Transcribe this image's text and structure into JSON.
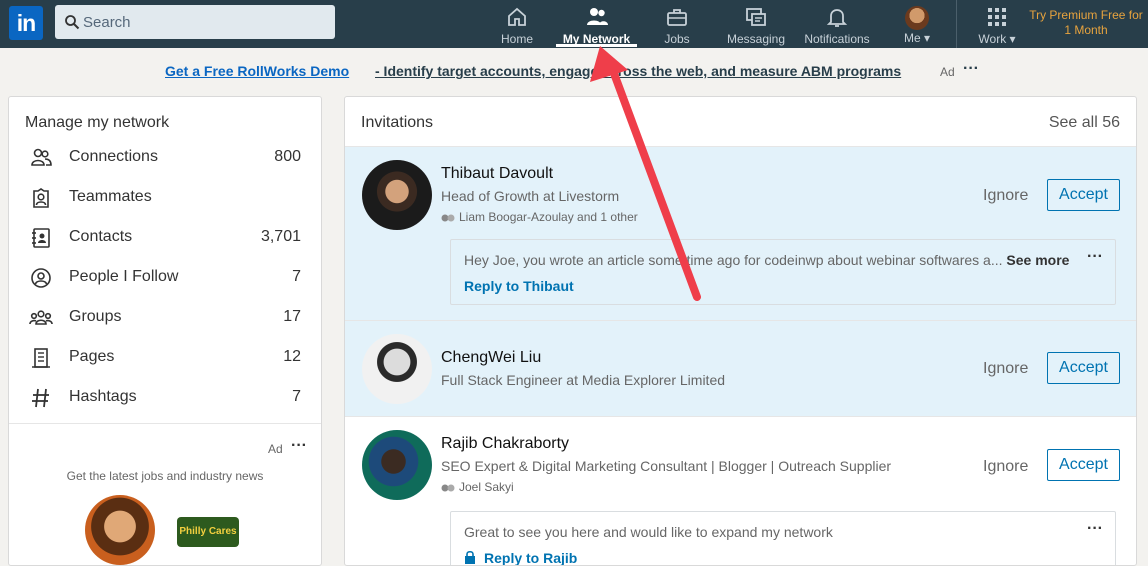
{
  "nav": {
    "logo": "in",
    "search_placeholder": "Search",
    "items": [
      {
        "label": "Home"
      },
      {
        "label": "My Network"
      },
      {
        "label": "Jobs"
      },
      {
        "label": "Messaging"
      },
      {
        "label": "Notifications"
      },
      {
        "label": "Me"
      },
      {
        "label": "Work"
      }
    ],
    "premium": "Try Premium Free for 1 Month"
  },
  "ad_banner": {
    "link": "Get a Free RollWorks Demo",
    "text": " - Identify target accounts, engage across the web, and measure ABM programs",
    "tag": "Ad",
    "dots": "···"
  },
  "manage": {
    "title": "Manage my network",
    "items": [
      {
        "label": "Connections",
        "count": "800",
        "icon": "connections-icon"
      },
      {
        "label": "Teammates",
        "count": "",
        "icon": "teammates-icon"
      },
      {
        "label": "Contacts",
        "count": "3,701",
        "icon": "contacts-icon"
      },
      {
        "label": "People I Follow",
        "count": "7",
        "icon": "people-follow-icon"
      },
      {
        "label": "Groups",
        "count": "17",
        "icon": "groups-icon"
      },
      {
        "label": "Pages",
        "count": "12",
        "icon": "pages-icon"
      },
      {
        "label": "Hashtags",
        "count": "7",
        "icon": "hashtag-icon"
      }
    ],
    "ad_tag": "Ad",
    "ad_dots": "···",
    "ad_text": "Get the latest jobs and industry news",
    "ad_logo_text": "Philly Cares"
  },
  "invitations": {
    "title": "Invitations",
    "see_all": "See all 56",
    "ignore_label": "Ignore",
    "accept_label": "Accept",
    "items": [
      {
        "name": "Thibaut Davoult",
        "headline": "Head of Growth at Livestorm",
        "mutual": "Liam Boogar-Azoulay and 1 other",
        "message": "Hey Joe, you wrote an article some time ago for codeinwp about webinar softwares a...",
        "see_more": "See more",
        "reply": "Reply to Thibaut"
      },
      {
        "name": "ChengWei Liu",
        "headline": "Full Stack Engineer at Media Explorer Limited"
      },
      {
        "name": "Rajib Chakraborty",
        "headline": "SEO Expert & Digital Marketing Consultant | Blogger | Outreach Supplier",
        "mutual": "Joel Sakyi",
        "message": "Great to see you here and would like to expand my network",
        "reply": "Reply to Rajib"
      }
    ]
  },
  "colors": {
    "nav_bg": "#283e4a",
    "accent": "#0073b1",
    "highlight_row": "#e3f2fa",
    "annotation_arrow": "#ef3e4a"
  }
}
